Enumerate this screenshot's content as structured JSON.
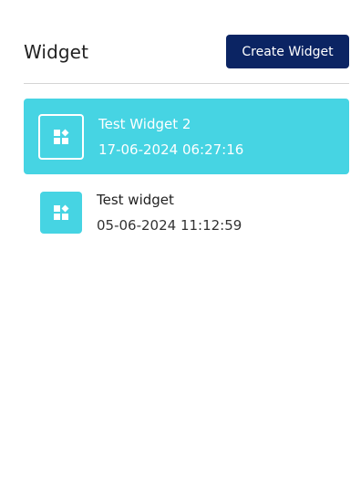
{
  "header": {
    "title": "Widget",
    "create_button_label": "Create Widget"
  },
  "widgets": [
    {
      "name": "Test Widget 2",
      "timestamp": "17-06-2024 06:27:16",
      "selected": true,
      "icon": "widget-grid-icon"
    },
    {
      "name": "Test widget",
      "timestamp": "05-06-2024 11:12:59",
      "selected": false,
      "icon": "widget-grid-icon"
    }
  ],
  "colors": {
    "accent": "#46d4e3",
    "primary_button": "#0b2463"
  }
}
